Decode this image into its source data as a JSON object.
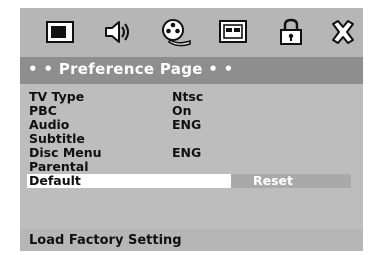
{
  "tabs": [
    {
      "icon": "tv-screen-icon"
    },
    {
      "icon": "audio-speaker-icon"
    },
    {
      "icon": "film-reel-icon"
    },
    {
      "icon": "video-display-icon"
    },
    {
      "icon": "lock-icon"
    },
    {
      "icon": "close-x-icon"
    }
  ],
  "page_title": "• • Preference Page • •",
  "menu": {
    "items": [
      {
        "label": "TV Type",
        "value": "Ntsc"
      },
      {
        "label": "PBC",
        "value": "On"
      },
      {
        "label": "Audio",
        "value": "ENG"
      },
      {
        "label": "Subtitle",
        "value": ""
      },
      {
        "label": "Disc Menu",
        "value": "ENG"
      },
      {
        "label": "Parental",
        "value": ""
      },
      {
        "label": "Default",
        "value": "",
        "option": "Reset",
        "selected": true
      }
    ]
  },
  "status_text": "Load Factory Setting",
  "colors": {
    "panel_gray": "#b6b6b6",
    "title_bar": "#8e8e8e",
    "selection_bar": "#ffffff",
    "option_bar": "#a9a9a9"
  }
}
